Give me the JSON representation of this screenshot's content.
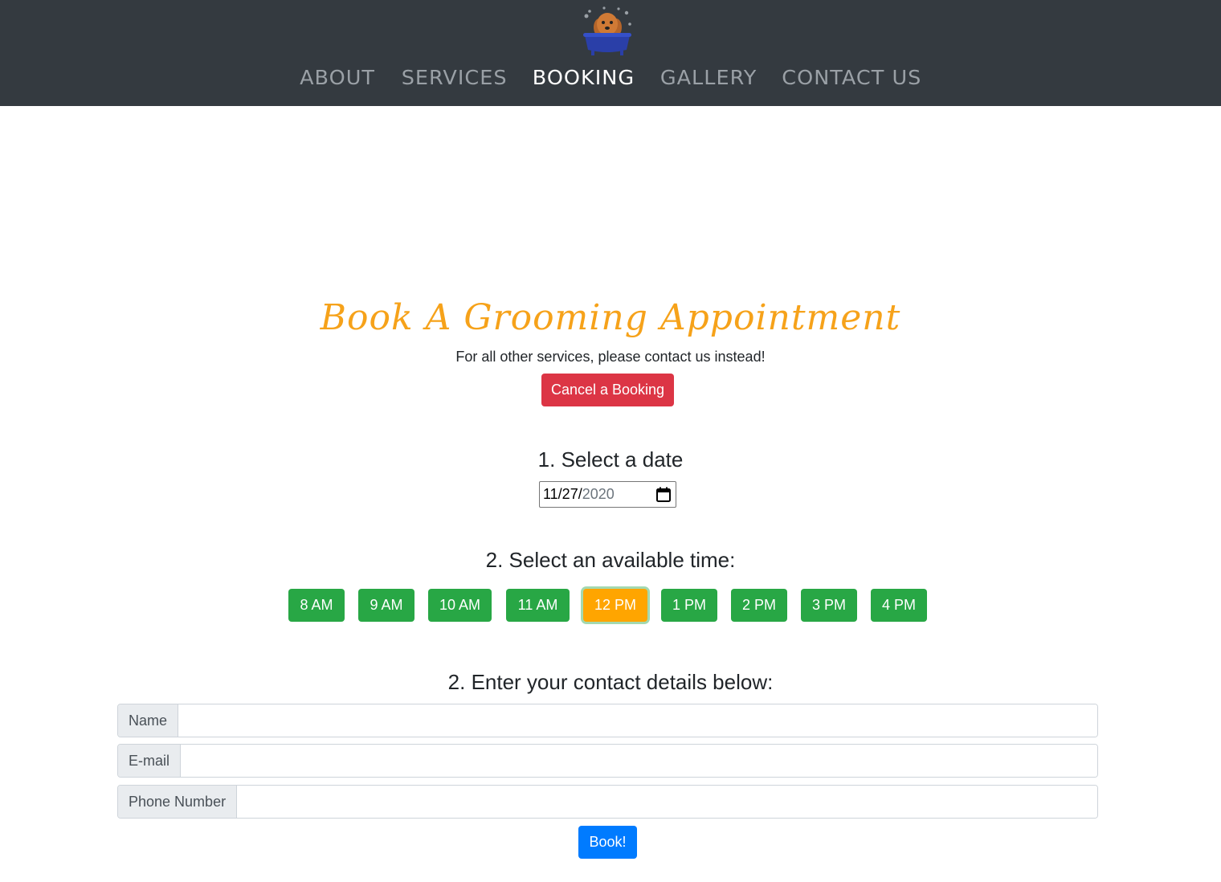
{
  "nav": {
    "items": [
      {
        "label": "ABOUT",
        "active": false
      },
      {
        "label": "SERVICES",
        "active": false
      },
      {
        "label": "BOOKING",
        "active": true
      },
      {
        "label": "GALLERY",
        "active": false
      },
      {
        "label": "CONTACT US",
        "active": false
      }
    ]
  },
  "main": {
    "heading": "Book A Grooming Appointment",
    "subtext": "For all other services, please contact us instead!",
    "cancel_label": "Cancel a Booking",
    "step1_title": "1. Select a date",
    "date": {
      "month_day": "11/27/",
      "year": "2020"
    },
    "step2_title": "2. Select an available time:",
    "times": [
      "8 AM",
      "9 AM",
      "10 AM",
      "11 AM",
      "12 PM",
      "1 PM",
      "2 PM",
      "3 PM",
      "4 PM"
    ],
    "selected_time": "12 PM",
    "step3_title": "2. Enter your contact details below:",
    "fields": {
      "name_label": "Name",
      "email_label": "E-mail",
      "phone_label": "Phone Number"
    },
    "book_label": "Book!"
  },
  "colors": {
    "navbar": "#343a40",
    "heading": "#f6a21a",
    "danger": "#dc3545",
    "success": "#28a745",
    "selected": "#ffa500",
    "primary": "#007bff"
  }
}
